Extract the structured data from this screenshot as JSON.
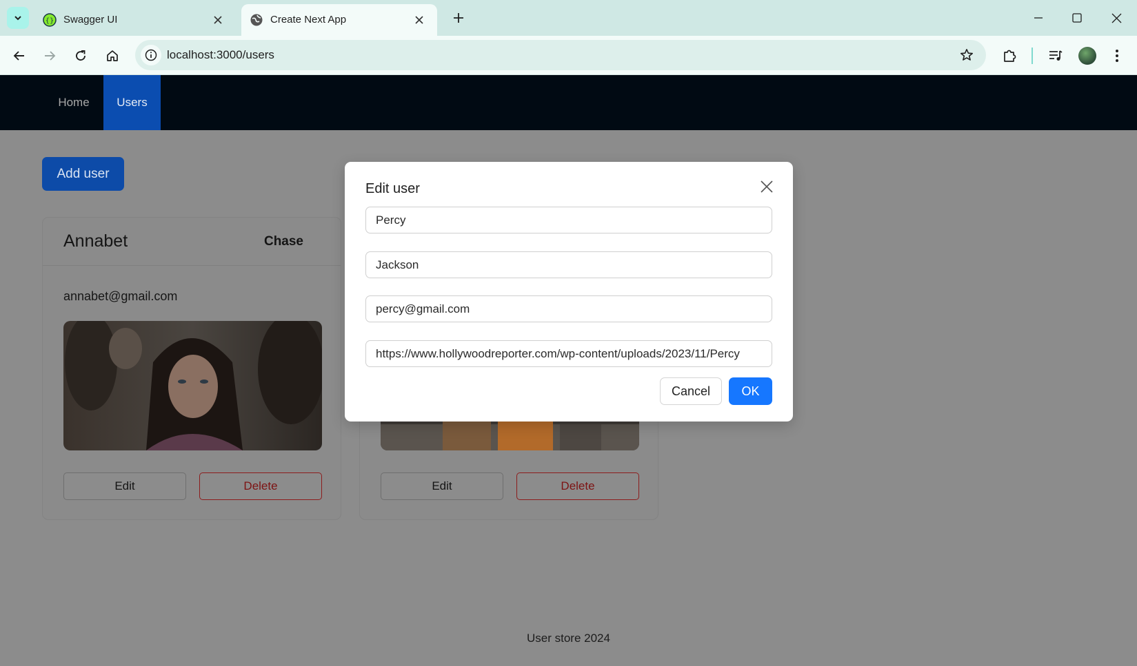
{
  "browser": {
    "tabs": [
      {
        "title": "Swagger UI",
        "icon": "swagger-icon",
        "active": false
      },
      {
        "title": "Create Next App",
        "icon": "globe-icon",
        "active": true
      }
    ],
    "url": "localhost:3000/users"
  },
  "nav": {
    "items": [
      {
        "label": "Home",
        "active": false
      },
      {
        "label": "Users",
        "active": true
      }
    ]
  },
  "page": {
    "add_user_label": "Add user",
    "footer": "User store 2024"
  },
  "users": [
    {
      "first_name": "Annabet",
      "last_name": "Chase",
      "email": "annabet@gmail.com",
      "edit_label": "Edit",
      "delete_label": "Delete"
    },
    {
      "edit_label": "Edit",
      "delete_label": "Delete"
    }
  ],
  "modal": {
    "title": "Edit user",
    "first_name": "Percy",
    "last_name": "Jackson",
    "email": "percy@gmail.com",
    "image_url": "https://www.hollywoodreporter.com/wp-content/uploads/2023/11/Percy",
    "cancel_label": "Cancel",
    "ok_label": "OK"
  },
  "colors": {
    "nav_bg": "#010a13",
    "nav_active": "#0b4db0",
    "primary": "#1677ff",
    "danger": "#7d1313",
    "overlay_page": "#8c8c8c"
  }
}
